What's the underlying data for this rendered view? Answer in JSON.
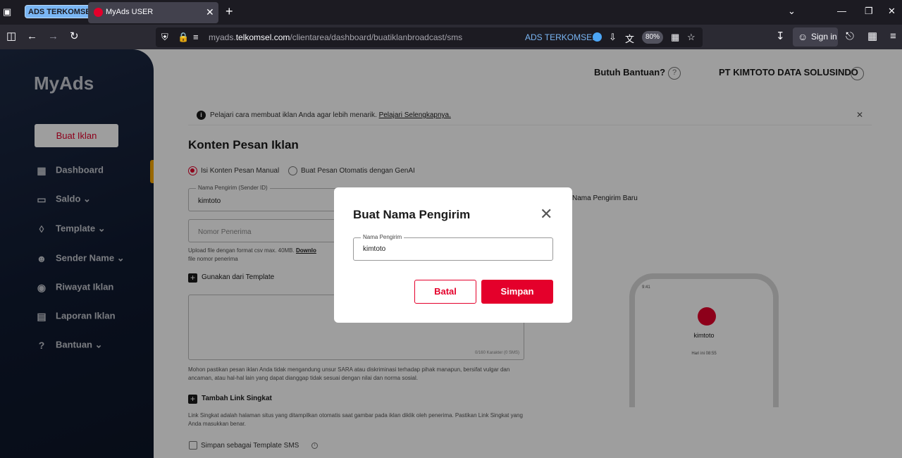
{
  "browser": {
    "tab_group_label": "ADS TERKOMSEL",
    "tab_title": "MyAds USER",
    "url_prefix": "myads.",
    "url_domain": "telkomsel.com",
    "url_path": "/clientarea/dashboard/buatiklanbroadcast/sms",
    "container_label": "ADS TERKOMSE...",
    "zoom": "80%",
    "sign_in": "Sign in"
  },
  "sidebar": {
    "logo": "MyAds",
    "create_button": "Buat Iklan",
    "items": [
      {
        "label": "Dashboard",
        "icon": "dashboard-icon"
      },
      {
        "label": "Saldo",
        "icon": "wallet-icon"
      },
      {
        "label": "Template",
        "icon": "layers-icon"
      },
      {
        "label": "Sender Name",
        "icon": "user-edit-icon"
      },
      {
        "label": "Riwayat Iklan",
        "icon": "broadcast-icon"
      },
      {
        "label": "Laporan Iklan",
        "icon": "document-icon"
      },
      {
        "label": "Bantuan",
        "icon": "question-icon"
      }
    ]
  },
  "header": {
    "help": "Butuh Bantuan?",
    "company": "PT KIMTOTO DATA SOLUSINDO"
  },
  "info": {
    "text": "Pelajari cara membuat iklan Anda agar lebih menarik.",
    "link": "Pelajari Selengkapnya."
  },
  "form": {
    "title": "Konten Pesan Iklan",
    "radio_manual": "Isi Konten Pesan Manual",
    "radio_genai": "Buat Pesan Otomatis dengan GenAI",
    "sender_label": "Nama Pengirim (Sender ID)",
    "sender_value": "kimtoto",
    "sender_new_link": "Nama Pengirim Baru",
    "recipient_placeholder": "Nomor Penerima",
    "upload_help": "Upload file dengan format csv max. 40MB.",
    "upload_link": "Downlo",
    "upload_help2": "file nomor penerima",
    "use_template": "Gunakan dari Template",
    "char_count": "0/160 Karakter (0 SMS)",
    "disclaimer": "Mohon pastikan pesan iklan Anda tidak mengandung unsur SARA atau diskriminasi terhadap pihak manapun, bersifat vulgar dan ancaman, atau hal-hal lain yang dapat dianggap tidak sesuai dengan nilai dan norma sosial.",
    "add_link": "Tambah Link Singkat",
    "link_help": "Link Singkat adalah halaman situs yang ditampilkan otomatis saat gambar pada iklan diklik oleh penerima. Pastikan Link Singkat yang Anda masukkan benar.",
    "save_template": "Simpan sebagai Template SMS"
  },
  "preview": {
    "time": "9:41",
    "sender": "kimtoto",
    "date": "Hari ini 08:55"
  },
  "modal": {
    "title": "Buat Nama Pengirim",
    "field_label": "Nama Pengirim",
    "field_value": "kimtoto",
    "cancel": "Batal",
    "save": "Simpan"
  },
  "colors": {
    "brand_red": "#e4002b",
    "sidebar_bg": "#101a30",
    "active_accent": "#f7a800"
  }
}
